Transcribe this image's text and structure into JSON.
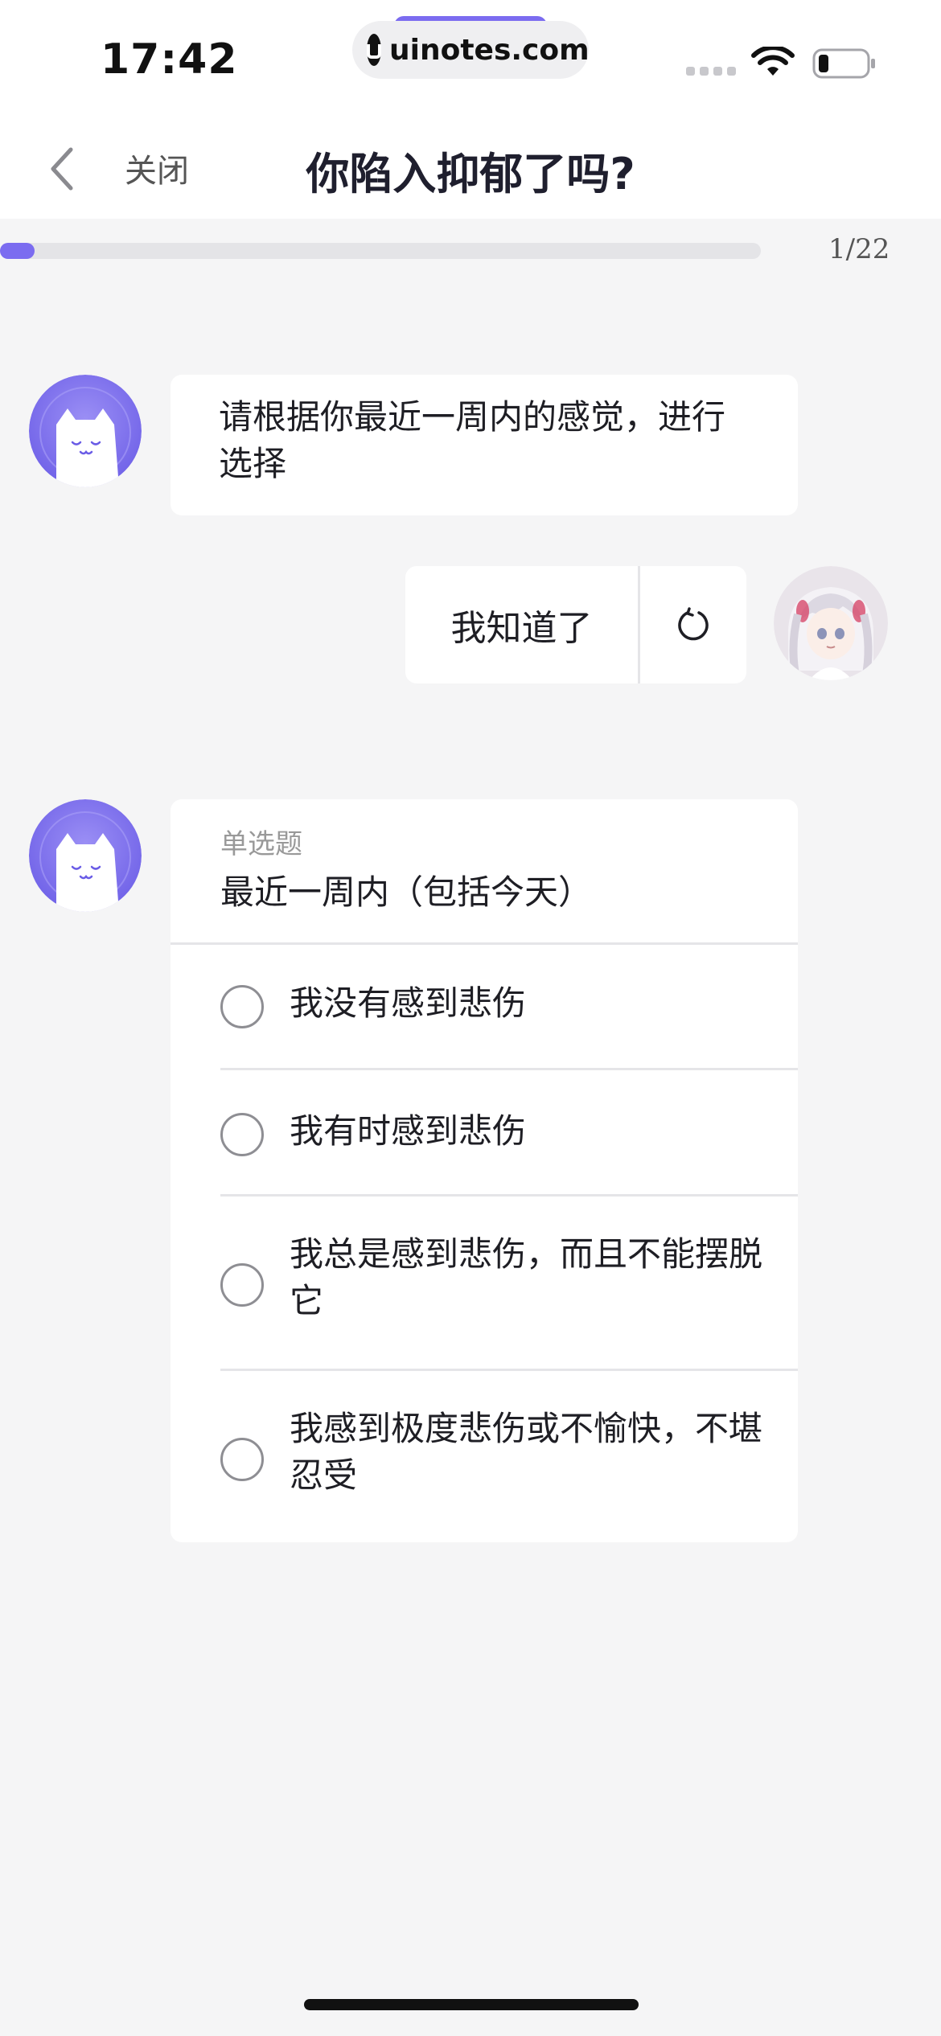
{
  "status_bar": {
    "time": "17:42",
    "url": "uinotes.com",
    "icons": [
      "signal-icon",
      "wifi-icon",
      "battery-icon"
    ]
  },
  "nav": {
    "back_icon": "chevron-left-icon",
    "close_label": "关闭",
    "title": "你陷入抑郁了吗?"
  },
  "progress": {
    "current": 1,
    "total": 22,
    "label": "1/22",
    "fill_fraction": 0.045,
    "color": "#7b6cf0"
  },
  "chat": {
    "intro_message": "请根据你最近一周内的感觉，进行选择",
    "reply": {
      "label": "我知道了",
      "redo_icon": "redo-icon"
    },
    "question": {
      "type_label": "单选题",
      "title": "最近一周内（包括今天）",
      "options": [
        "我没有感到悲伤",
        "我有时感到悲伤",
        "我总是感到悲伤，而且不能摆脱它",
        "我感到极度悲伤或不愉快，不堪忍受"
      ]
    }
  },
  "colors": {
    "accent": "#7b6cf0",
    "background": "#f5f5f6",
    "card": "#ffffff"
  }
}
